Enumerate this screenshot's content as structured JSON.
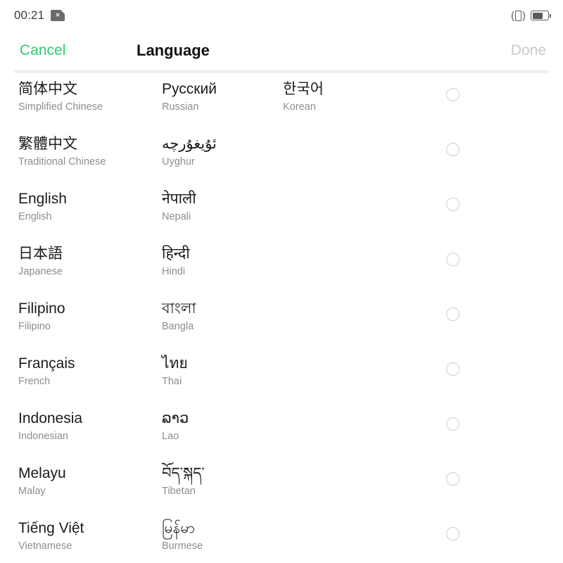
{
  "status_bar": {
    "time": "00:21",
    "sim_icon": "sim-error-icon",
    "sim_badge_mark": "×",
    "vibrate_icon": "vibrate-mode-icon",
    "battery_icon": "battery-icon",
    "battery_level_percent": 68
  },
  "header": {
    "cancel_label": "Cancel",
    "title": "Language",
    "done_label": "Done",
    "cancel_color": "#2ece71",
    "done_color": "#c9c9c9",
    "done_enabled": false
  },
  "colors": {
    "accent_green": "#2ece71",
    "native_text": "#1c1c1c",
    "english_text": "#8d8d8d",
    "radio_border": "#cfcfcf",
    "separator": "#f0f0f0",
    "background": "#ffffff"
  },
  "language_list": {
    "selected_index": -1,
    "columns": 3,
    "rows": [
      {
        "cells": [
          {
            "native": "简体中文",
            "english": "Simplified Chinese"
          },
          {
            "native": "Русский",
            "english": "Russian"
          },
          {
            "native": "한국어",
            "english": "Korean"
          }
        ]
      },
      {
        "cells": [
          {
            "native": "繁體中文",
            "english": "Traditional Chinese"
          },
          {
            "native": "ئۇيغۇرچە",
            "english": "Uyghur"
          }
        ]
      },
      {
        "cells": [
          {
            "native": "English",
            "english": "English"
          },
          {
            "native": "नेपाली",
            "english": "Nepali"
          }
        ]
      },
      {
        "cells": [
          {
            "native": "日本語",
            "english": "Japanese"
          },
          {
            "native": "हिन्दी",
            "english": "Hindi"
          }
        ]
      },
      {
        "cells": [
          {
            "native": "Filipino",
            "english": "Filipino"
          },
          {
            "native": "বাংলা",
            "english": "Bangla"
          }
        ]
      },
      {
        "cells": [
          {
            "native": "Français",
            "english": "French"
          },
          {
            "native": "ไทย",
            "english": "Thai"
          }
        ]
      },
      {
        "cells": [
          {
            "native": "Indonesia",
            "english": "Indonesian"
          },
          {
            "native": "ລາວ",
            "english": "Lao"
          }
        ]
      },
      {
        "cells": [
          {
            "native": "Melayu",
            "english": "Malay"
          },
          {
            "native": "བོད་སྐད་",
            "english": "Tibetan"
          }
        ]
      },
      {
        "cells": [
          {
            "native": "Tiếng Việt",
            "english": "Vietnamese"
          },
          {
            "native": "မြန်မာ",
            "english": "Burmese"
          }
        ]
      }
    ]
  }
}
